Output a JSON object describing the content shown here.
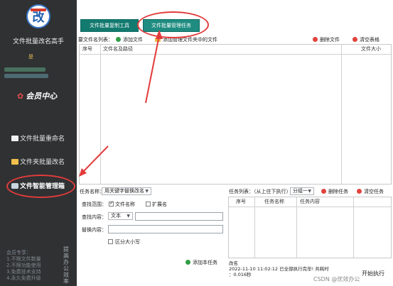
{
  "sidebar": {
    "logo_badge": "LOGO",
    "logo_char": "改",
    "title": "文件批量改名高手",
    "user_line": "是",
    "member_label": "会员中心",
    "nav": [
      {
        "label": "文件批量重命名",
        "icon": "document-icon"
      },
      {
        "label": "文件夹批量改名",
        "icon": "folder-icon"
      },
      {
        "label": "文件智能管理箱",
        "icon": "toolbox-icon"
      }
    ],
    "promo_lines": [
      "会员专享：",
      "1.不限文件数量",
      "2.不限功能使用",
      "3.免费技术支持",
      "4.永久免费升级"
    ],
    "vertical_text": "提高办公效率"
  },
  "tabs": [
    {
      "label": "文件批量复制工具"
    },
    {
      "label": "文件批量管理任务",
      "active": true
    }
  ],
  "file_list": {
    "heading": "要文件名列表：",
    "add_file": "添加文件",
    "add_folder_files": "添加管理文件夹中的文件",
    "delete_file": "删除文件",
    "clear_table": "清空表格",
    "columns": [
      "序号",
      "文件名及路径",
      "文件大小"
    ]
  },
  "rules": {
    "task_name_label": "任务名称：",
    "task_name_value": "用关键字替换改名",
    "scope_label": "查找范围：",
    "scope_filename": "文件名称",
    "scope_filename_checked": true,
    "scope_extension": "扩展名",
    "scope_extension_checked": false,
    "find_label": "查找内容：",
    "find_type": "文本",
    "find_value": "",
    "replace_label": "替换内容：",
    "replace_value": "",
    "case_sensitive": "区分大小写",
    "case_sensitive_checked": false,
    "add_task": "添加本任务"
  },
  "tasks": {
    "heading": "任务列表：（从上往下执行）",
    "group": "分组一",
    "delete_task": "删除任务",
    "clear_tasks": "清空任务",
    "columns": [
      "序号",
      "任务名称",
      "任务内容"
    ],
    "log_line1": "改名",
    "log_line2": "2022-11-10 11:02:12 已全部执行完毕! 共耗时",
    "log_line3": "：0.016秒",
    "start": "开始执行"
  },
  "watermark": "CSDN @优效办公"
}
